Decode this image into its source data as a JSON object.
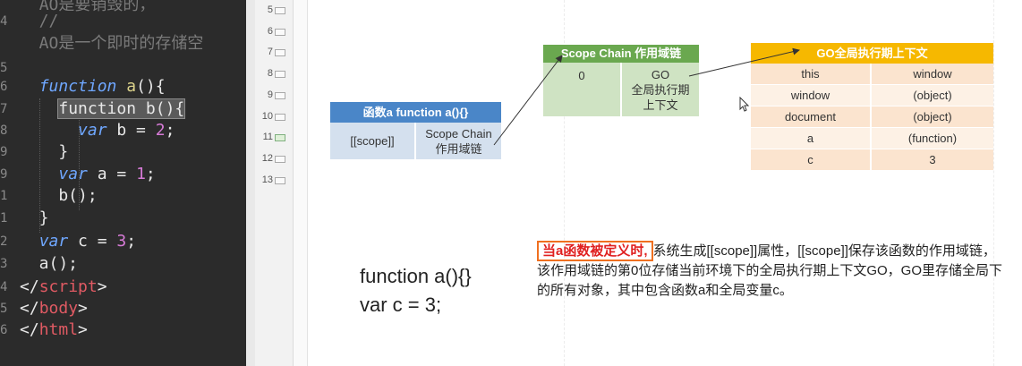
{
  "editor": {
    "lines": [
      {
        "gutter": "",
        "parts": [
          {
            "t": "  ",
            "c": "pl"
          },
          {
            "t": "AO是要销毁的，",
            "c": "cmt"
          }
        ]
      },
      {
        "gutter": "4",
        "parts": [
          {
            "t": "  //",
            "c": "cmt"
          }
        ]
      },
      {
        "gutter": "",
        "parts": [
          {
            "t": "  AO是一个即时的存储空",
            "c": "cmt"
          }
        ]
      },
      {
        "gutter": "5",
        "parts": []
      },
      {
        "gutter": "6",
        "parts": [
          {
            "t": "  ",
            "c": "pl"
          },
          {
            "t": "function",
            "c": "kw"
          },
          {
            "t": " ",
            "c": "pl"
          },
          {
            "t": "a",
            "c": "fn"
          },
          {
            "t": "(){",
            "c": "pl"
          }
        ]
      },
      {
        "gutter": "7",
        "parts": [
          {
            "t": "    ",
            "c": "pl"
          },
          {
            "t": "function b(){",
            "c": "pl hl"
          }
        ]
      },
      {
        "gutter": "8",
        "parts": [
          {
            "t": "      ",
            "c": "pl"
          },
          {
            "t": "var",
            "c": "kw"
          },
          {
            "t": " b = ",
            "c": "pl"
          },
          {
            "t": "2",
            "c": "num"
          },
          {
            "t": ";",
            "c": "pl"
          }
        ]
      },
      {
        "gutter": "9",
        "parts": [
          {
            "t": "    }",
            "c": "pl"
          }
        ]
      },
      {
        "gutter": "9",
        "parts": [
          {
            "t": "    ",
            "c": "pl"
          },
          {
            "t": "var",
            "c": "kw"
          },
          {
            "t": " a = ",
            "c": "pl"
          },
          {
            "t": "1",
            "c": "num"
          },
          {
            "t": ";",
            "c": "pl"
          }
        ]
      },
      {
        "gutter": "1",
        "parts": [
          {
            "t": "    b();",
            "c": "pl"
          }
        ]
      },
      {
        "gutter": "1",
        "parts": [
          {
            "t": "  }",
            "c": "pl"
          }
        ]
      },
      {
        "gutter": "2",
        "parts": [
          {
            "t": "  ",
            "c": "pl"
          },
          {
            "t": "var",
            "c": "kw"
          },
          {
            "t": " c = ",
            "c": "pl"
          },
          {
            "t": "3",
            "c": "num"
          },
          {
            "t": ";",
            "c": "pl"
          }
        ]
      },
      {
        "gutter": "3",
        "parts": [
          {
            "t": "  a();",
            "c": "pl"
          }
        ]
      },
      {
        "gutter": "4",
        "parts": [
          {
            "t": "</",
            "c": "pl"
          },
          {
            "t": "script",
            "c": "tg"
          },
          {
            "t": ">",
            "c": "pl"
          }
        ]
      },
      {
        "gutter": "5",
        "parts": [
          {
            "t": "</",
            "c": "pl"
          },
          {
            "t": "body",
            "c": "tg"
          },
          {
            "t": ">",
            "c": "pl"
          }
        ]
      },
      {
        "gutter": "6",
        "parts": [
          {
            "t": "</",
            "c": "pl"
          },
          {
            "t": "html",
            "c": "tg"
          },
          {
            "t": ">",
            "c": "pl"
          }
        ]
      }
    ]
  },
  "slide_panel": {
    "line_numbers": [
      "5",
      "6",
      "7",
      "8",
      "9",
      "10",
      "11",
      "12",
      "13"
    ]
  },
  "func_box": {
    "header": "函数a    function a(){}",
    "col1": "[[scope]]",
    "col2": "Scope Chain\n作用域链",
    "header_color": "#4a86c8",
    "body_color": "#d4e0ee"
  },
  "scope_box": {
    "header": "Scope Chain 作用域链",
    "col1": "0",
    "col2": "GO\n全局执行期\n上下文",
    "header_color": "#6aa84f",
    "body_color": "#cfe3c3"
  },
  "go_box": {
    "header": "GO全局执行期上下文",
    "header_color": "#f6b800",
    "row_color_a": "#fbe4cf",
    "row_color_b": "#fdf1e5",
    "rows": [
      {
        "key": "this",
        "value": "window"
      },
      {
        "key": "window",
        "value": "(object)"
      },
      {
        "key": "document",
        "value": "(object)"
      },
      {
        "key": "a",
        "value": "(function)"
      },
      {
        "key": "c",
        "value": "3"
      }
    ]
  },
  "code_sample": {
    "line1": "function a(){}",
    "line2": "var c = 3;"
  },
  "description": {
    "highlight": "当a函数被定义时,",
    "text": "系统生成[[scope]]属性，[[scope]]保存该函数的作用域链，该作用域链的第0位存储当前环境下的全局执行期上下文GO，GO里存储全局下的所有对象，其中包含函数a和全局变量c。"
  }
}
